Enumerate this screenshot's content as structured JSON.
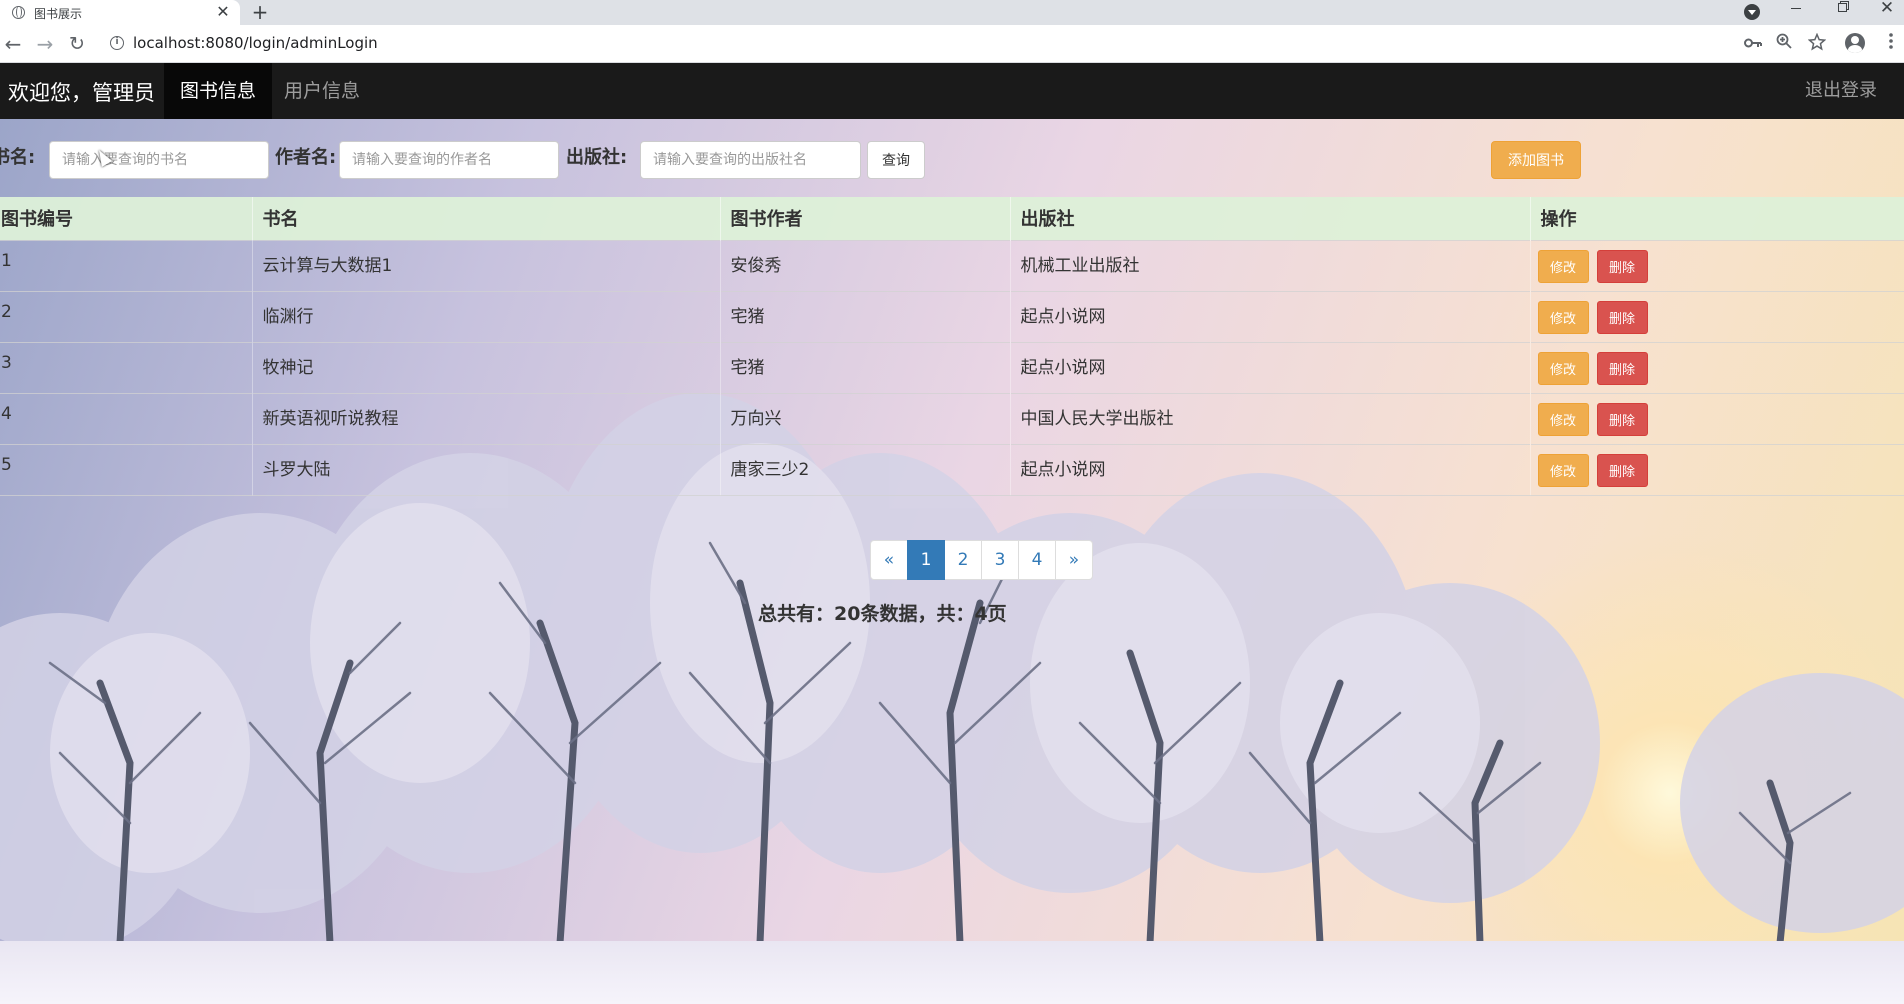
{
  "browser": {
    "tab_title": "图书展示",
    "tab_close": "✕",
    "new_tab": "+",
    "url": "localhost:8080/login/adminLogin",
    "nav_back": "←",
    "nav_forward": "→",
    "nav_reload": "↻",
    "info_icon": "i",
    "win_close": "✕",
    "icons": [
      "globe-icon",
      "close-icon",
      "plus-icon",
      "tab-search-icon",
      "minimize-icon",
      "restore-icon",
      "window-close-icon",
      "back-icon",
      "forward-icon",
      "reload-icon",
      "info-icon",
      "key-icon",
      "zoom-icon",
      "star-icon",
      "profile-icon",
      "menu-icon"
    ]
  },
  "navbar": {
    "brand": "欢迎您，管理员",
    "items": [
      {
        "label": "图书信息",
        "active": true
      },
      {
        "label": "用户信息",
        "active": false
      }
    ],
    "logout": "退出登录"
  },
  "search": {
    "name_label": "书名:",
    "name_placeholder": "请输入要查询的书名",
    "author_label": "作者名:",
    "author_placeholder": "请输入要查询的作者名",
    "publisher_label": "出版社:",
    "publisher_placeholder": "请输入要查询的出版社名",
    "query_button": "查询",
    "add_button": "添加图书"
  },
  "table": {
    "headers": [
      "图书编号",
      "书名",
      "图书作者",
      "出版社",
      "操作"
    ],
    "edit_label": "修改",
    "delete_label": "删除",
    "rows": [
      {
        "id": "1",
        "name": "云计算与大数据1",
        "author": "安俊秀",
        "publisher": "机械工业出版社"
      },
      {
        "id": "2",
        "name": "临渊行",
        "author": "宅猪",
        "publisher": "起点小说网"
      },
      {
        "id": "3",
        "name": "牧神记",
        "author": "宅猪",
        "publisher": "起点小说网"
      },
      {
        "id": "4",
        "name": "新英语视听说教程",
        "author": "万向兴",
        "publisher": "中国人民大学出版社"
      },
      {
        "id": "5",
        "name": "斗罗大陆",
        "author": "唐家三少2",
        "publisher": "起点小说网"
      }
    ]
  },
  "pagination": {
    "prev": "«",
    "pages": [
      "1",
      "2",
      "3",
      "4"
    ],
    "active_page": "1",
    "next": "»",
    "summary": "总共有：20条数据，共：4页"
  },
  "colors": {
    "navbar": "#1a1a1a",
    "header_row": "#ddf0d8",
    "warning": "#f0ad4e",
    "danger": "#d9534f",
    "primary": "#337ab7"
  }
}
